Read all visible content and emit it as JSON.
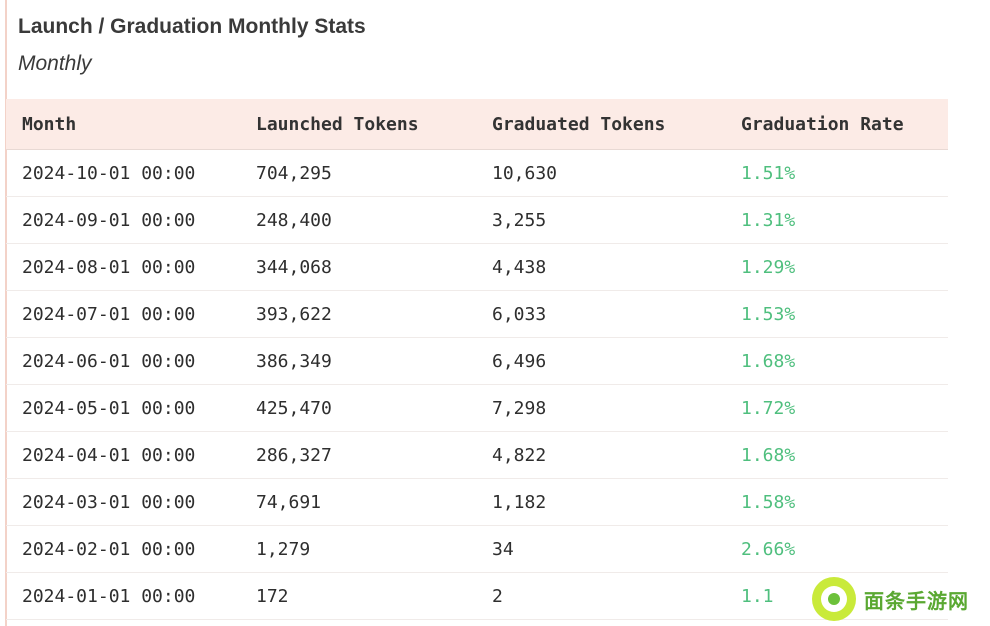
{
  "header": {
    "title": "Launch / Graduation Monthly Stats",
    "subtitle": "Monthly"
  },
  "table": {
    "columns": [
      "Month",
      "Launched Tokens",
      "Graduated Tokens",
      "Graduation Rate"
    ],
    "rows": [
      {
        "month": "2024-10-01 00:00",
        "launched": "704,295",
        "graduated": "10,630",
        "rate": "1.51%"
      },
      {
        "month": "2024-09-01 00:00",
        "launched": "248,400",
        "graduated": "3,255",
        "rate": "1.31%"
      },
      {
        "month": "2024-08-01 00:00",
        "launched": "344,068",
        "graduated": "4,438",
        "rate": "1.29%"
      },
      {
        "month": "2024-07-01 00:00",
        "launched": "393,622",
        "graduated": "6,033",
        "rate": "1.53%"
      },
      {
        "month": "2024-06-01 00:00",
        "launched": "386,349",
        "graduated": "6,496",
        "rate": "1.68%"
      },
      {
        "month": "2024-05-01 00:00",
        "launched": "425,470",
        "graduated": "7,298",
        "rate": "1.72%"
      },
      {
        "month": "2024-04-01 00:00",
        "launched": "286,327",
        "graduated": "4,822",
        "rate": "1.68%"
      },
      {
        "month": "2024-03-01 00:00",
        "launched": "74,691",
        "graduated": "1,182",
        "rate": "1.58%"
      },
      {
        "month": "2024-02-01 00:00",
        "launched": "1,279",
        "graduated": "34",
        "rate": "2.66%"
      },
      {
        "month": "2024-01-01 00:00",
        "launched": "172",
        "graduated": "2",
        "rate": "1.1"
      }
    ]
  },
  "colors": {
    "header_bg": "#fcebe6",
    "rate_green": "#4fbf7e",
    "left_rule": "#f3d2c8"
  },
  "watermark": {
    "text": "面条手游网",
    "icon": "noodle-logo-icon"
  }
}
